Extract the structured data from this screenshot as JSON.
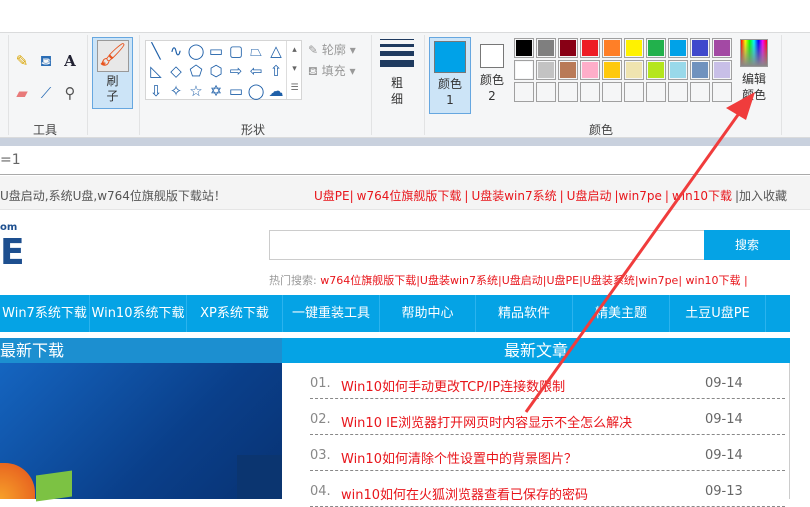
{
  "ribbon": {
    "tools_label": "工具",
    "brush_label": "刷子",
    "shapes_label": "形状",
    "outline_label": "轮廓",
    "fill_label": "填充",
    "size_label": "粗细",
    "color1_label": "颜色 1",
    "color2_label": "颜色 2",
    "colors_label": "颜色",
    "edit_colors_label": "编辑颜色",
    "color1": "#00a2e8",
    "color2": "#ffffff",
    "palette": [
      "#000000",
      "#7f7f7f",
      "#880015",
      "#ed1c24",
      "#ff7f27",
      "#fff200",
      "#22b14c",
      "#00a2e8",
      "#3f48cc",
      "#a349a4",
      "#ffffff",
      "#c3c3c3",
      "#b97a57",
      "#ffaec9",
      "#ffc90e",
      "#efe4b0",
      "#b5e61d",
      "#99d9ea",
      "#7092be",
      "#c8bfe7"
    ]
  },
  "coord_text": "=1",
  "web": {
    "tagline": "U盘启动,系统U盘,w764位旗舰版下载站！",
    "top_links": [
      "U盘PE|",
      "w764位旗舰版下载",
      "|",
      "U盘装win7系统",
      "|",
      "U盘启动",
      "|win7pe",
      "|",
      "win10下载",
      "|加入收藏"
    ],
    "search_button": "搜索",
    "hot_label": "热门搜索:",
    "hot_links": "w764位旗舰版下载|U盘装win7系统|U盘启动|U盘PE|U盘装系统|win7pe| win10下载 |",
    "nav": [
      "Win7系统下载",
      "Win10系统下载",
      "XP系统下载",
      "一键重装工具",
      "帮助中心",
      "精品软件",
      "精美主题",
      "土豆U盘PE"
    ],
    "latest_download": "最新下载",
    "latest_articles": "最新文章",
    "articles": [
      {
        "num": "01.",
        "title": "Win10如何手动更改TCP/IP连接数限制",
        "date": "09-14"
      },
      {
        "num": "02.",
        "title": "Win10 IE浏览器打开网页时内容显示不全怎么解决",
        "date": "09-14"
      },
      {
        "num": "03.",
        "title": "Win10如何清除个性设置中的背景图片？",
        "date": "09-14"
      },
      {
        "num": "04.",
        "title": "win10如何在火狐浏览器查看已保存的密码",
        "date": "09-13"
      }
    ],
    "arrow_color": "#f03c3c"
  }
}
